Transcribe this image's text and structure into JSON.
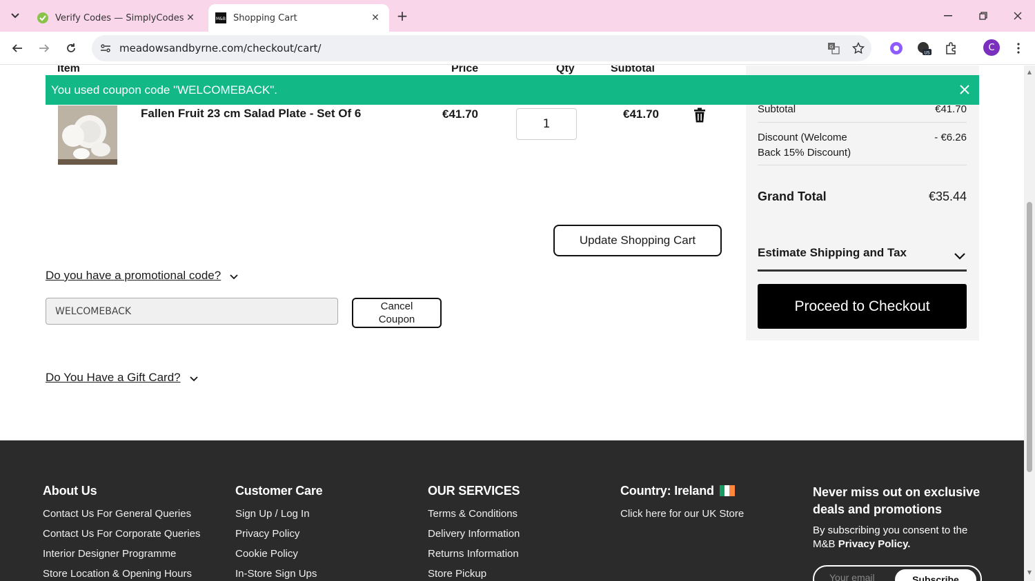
{
  "browser": {
    "tabs": [
      {
        "title": "Verify Codes — SimplyCodes",
        "active": false,
        "favicon": "simplycodes-icon"
      },
      {
        "title": "Shopping Cart",
        "active": true,
        "favicon": "mb-logo-icon"
      }
    ],
    "url": "meadowsandbyrne.com/checkout/cart/"
  },
  "cart": {
    "headers": {
      "item": "Item",
      "price": "Price",
      "qty": "Qty",
      "subtotal": "Subtotal"
    },
    "notice": "You used coupon code \"WELCOMEBACK\".",
    "item": {
      "name": "Fallen Fruit 23 cm Salad Plate - Set Of 6",
      "price": "€41.70",
      "qty": "1",
      "subtotal": "€41.70"
    },
    "update_label": "Update Shopping Cart",
    "promo_label": "Do you have a promotional code?",
    "promo_value": "WELCOMEBACK",
    "cancel_coupon_line1": "Cancel",
    "cancel_coupon_line2": "Coupon",
    "gift_label": "Do You Have a Gift Card?"
  },
  "summary": {
    "subtotal_label": "Subtotal",
    "subtotal_value": "€41.70",
    "discount_label_1": "Discount (Welcome",
    "discount_label_2": "Back 15% Discount)",
    "discount_value": "- €6.26",
    "grand_label": "Grand Total",
    "grand_value": "€35.44",
    "estimate_label": "Estimate Shipping and Tax",
    "checkout_label": "Proceed to Checkout"
  },
  "footer": {
    "about": {
      "title": "About Us",
      "links": [
        "Contact Us For General Queries",
        "Contact Us For Corporate Queries",
        "Interior Designer Programme",
        "Store Location & Opening Hours"
      ]
    },
    "care": {
      "title": "Customer Care",
      "links": [
        "Sign Up / Log In",
        "Privacy Policy",
        "Cookie Policy",
        "In-Store Sign Ups"
      ]
    },
    "services": {
      "title": "OUR SERVICES",
      "links": [
        "Terms & Conditions",
        "Delivery Information",
        "Returns Information",
        "Store Pickup"
      ]
    },
    "country": {
      "title": "Country: Ireland",
      "link": "Click here for our UK Store"
    },
    "newsletter": {
      "title": "Never miss out on exclusive deals and promotions",
      "text": "By subscribing you consent to the M&B",
      "policy": "Privacy Policy.",
      "placeholder": "Your email",
      "subscribe": "Subscribe"
    }
  },
  "colors": {
    "tabbar": "#f9d6ea",
    "notice": "#12b886",
    "footer": "#2b2b2b",
    "checkout": "#000000"
  }
}
